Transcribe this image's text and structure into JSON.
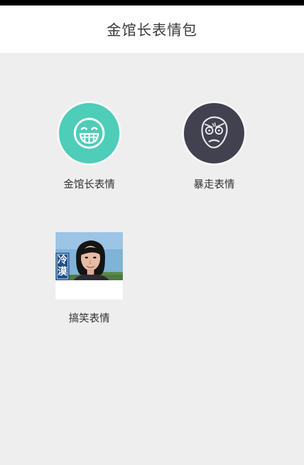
{
  "header": {
    "title": "金馆长表情包"
  },
  "categories": [
    {
      "label": "金馆长表情",
      "icon": "grin-face-icon",
      "color": "#4ecdb8"
    },
    {
      "label": "暴走表情",
      "icon": "rage-face-icon",
      "color": "#42414f"
    },
    {
      "label": "搞笑表情",
      "icon": "photo-thumbnail"
    }
  ],
  "thumbnail": {
    "banner_text": "冷漠"
  }
}
